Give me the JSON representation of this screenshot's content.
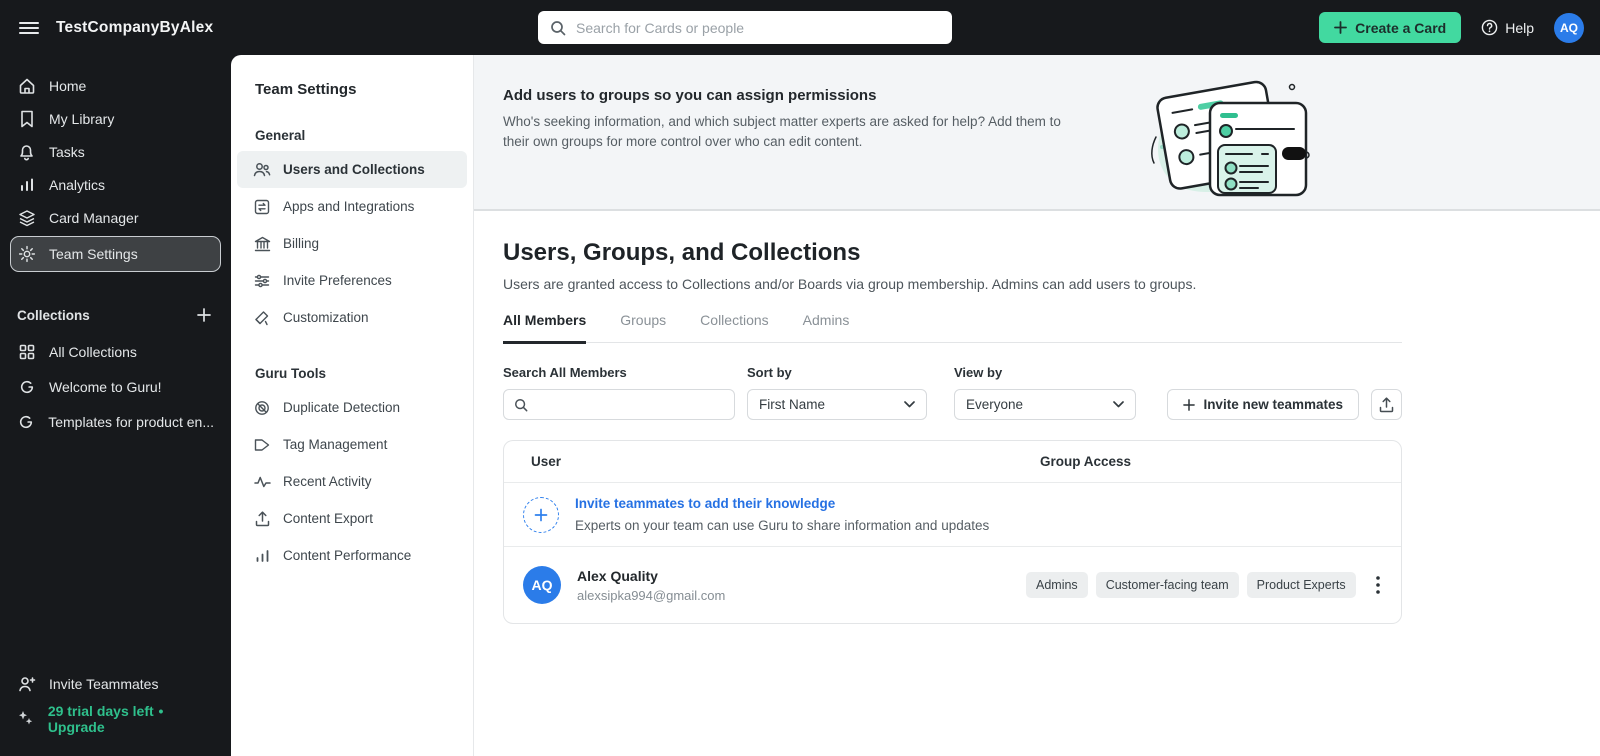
{
  "topbar": {
    "company_name": "TestCompanyByAlex",
    "search_placeholder": "Search for Cards or people",
    "create_card_label": "Create a Card",
    "help_label": "Help",
    "avatar_initials": "AQ"
  },
  "sidebar": {
    "nav_items": [
      {
        "label": "Home",
        "icon": "home-icon"
      },
      {
        "label": "My Library",
        "icon": "bookmark-icon"
      },
      {
        "label": "Tasks",
        "icon": "bell-icon"
      },
      {
        "label": "Analytics",
        "icon": "bar-chart-icon"
      },
      {
        "label": "Card Manager",
        "icon": "layers-icon"
      },
      {
        "label": "Team Settings",
        "icon": "gear-icon",
        "selected": true
      }
    ],
    "collections_header": "Collections",
    "collection_items": [
      {
        "label": "All Collections",
        "icon": "grid-icon"
      },
      {
        "label": "Welcome to Guru!",
        "icon": "guru-logo-icon"
      },
      {
        "label": "Templates for product en...",
        "icon": "guru-logo-icon"
      }
    ],
    "invite_teammates_label": "Invite Teammates",
    "trial_text": "29 trial days left",
    "trial_separator": "•",
    "upgrade_label": "Upgrade"
  },
  "settings_panel": {
    "title": "Team Settings",
    "general_header": "General",
    "general_items": [
      {
        "label": "Users and Collections",
        "icon": "people-icon",
        "selected": true
      },
      {
        "label": "Apps and Integrations",
        "icon": "integrations-icon"
      },
      {
        "label": "Billing",
        "icon": "bank-icon"
      },
      {
        "label": "Invite Preferences",
        "icon": "sliders-icon"
      },
      {
        "label": "Customization",
        "icon": "paint-icon"
      }
    ],
    "tools_header": "Guru Tools",
    "tools_items": [
      {
        "label": "Duplicate Detection",
        "icon": "duplicate-icon"
      },
      {
        "label": "Tag Management",
        "icon": "tag-icon"
      },
      {
        "label": "Recent Activity",
        "icon": "activity-icon"
      },
      {
        "label": "Content Export",
        "icon": "upload-icon"
      },
      {
        "label": "Content Performance",
        "icon": "performance-icon"
      }
    ]
  },
  "main": {
    "banner": {
      "title": "Add users to groups so you can assign permissions",
      "body": "Who's seeking information, and which subject matter experts are asked for help? Add them to their own groups for more control over who can edit content."
    },
    "page_title": "Users, Groups, and Collections",
    "page_description": "Users are granted access to Collections and/or Boards via group membership. Admins can add users to groups.",
    "tabs": [
      {
        "label": "All Members",
        "active": true
      },
      {
        "label": "Groups",
        "active": false
      },
      {
        "label": "Collections",
        "active": false
      },
      {
        "label": "Admins",
        "active": false
      }
    ],
    "filters": {
      "search_label": "Search All Members",
      "sort_label": "Sort by",
      "sort_value": "First Name",
      "view_label": "View by",
      "view_value": "Everyone",
      "invite_button_label": "Invite new teammates"
    },
    "table": {
      "col_user": "User",
      "col_groups": "Group Access",
      "invite_row": {
        "title": "Invite teammates to add their knowledge",
        "subtitle": "Experts on your team can use Guru to share information and updates"
      },
      "users": [
        {
          "initials": "AQ",
          "name": "Alex Quality",
          "email": "alexsipka994@gmail.com",
          "groups": [
            "Admins",
            "Customer-facing team",
            "Product Experts"
          ]
        }
      ]
    }
  },
  "colors": {
    "dark_bg": "#17191c",
    "accent_green": "#42d9a0",
    "trial_green": "#2fc08c",
    "avatar_blue": "#2b7ce9",
    "link_blue": "#2671e3",
    "selected_item_bg": "#eef1f2"
  }
}
